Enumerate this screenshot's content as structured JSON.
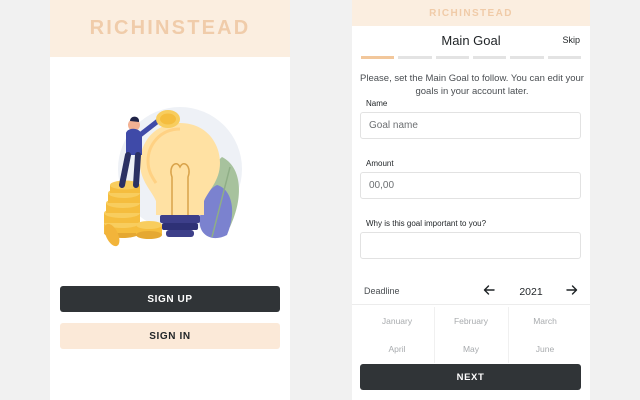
{
  "left_screen": {
    "brand": "RICHINSTEAD",
    "illustration": "person-on-coin-stacks-with-lightbulb",
    "signup_label": "SIGN UP",
    "signin_label": "SIGN IN"
  },
  "right_screen": {
    "brand": "RICHINSTEAD",
    "title": "Main Goal",
    "skip_label": "Skip",
    "progress": {
      "current_step": 1,
      "total_steps": 6
    },
    "intro": "Please, set the Main Goal to follow. You can edit your goals in your account later.",
    "fields": {
      "name": {
        "label": "Name",
        "placeholder": "Goal name",
        "value": ""
      },
      "amount": {
        "label": "Amount",
        "placeholder": "00,00",
        "value": ""
      },
      "why": {
        "label": "Why is this goal important to you?",
        "placeholder": "",
        "value": ""
      }
    },
    "deadline": {
      "label": "Deadline",
      "year": "2021",
      "months": [
        "January",
        "February",
        "March",
        "April",
        "May",
        "June"
      ]
    },
    "next_label": "NEXT"
  },
  "colors": {
    "brand_bg": "#fbeee0",
    "brand_text": "#f0ccaa",
    "dark_button": "#303437",
    "light_button": "#fbe9d8",
    "progress_active": "#f2c79b"
  },
  "icons": {
    "prev": "arrow-left-icon",
    "next": "arrow-right-icon"
  }
}
